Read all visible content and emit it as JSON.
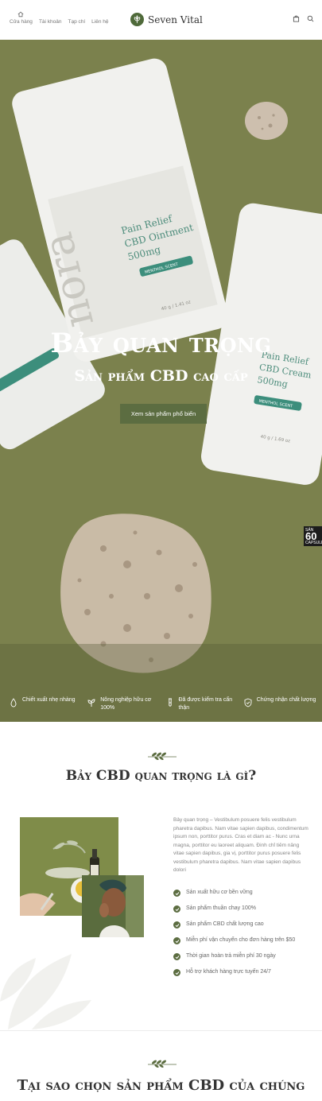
{
  "header": {
    "nav": [
      {
        "label": "Cửa hàng",
        "icon": "home-icon"
      },
      {
        "label": "Tài khoản"
      },
      {
        "label": "Tạp chí"
      },
      {
        "label": "Liên hệ"
      }
    ],
    "logo_text": "Seven Vital",
    "icons": [
      "bag-icon",
      "search-icon"
    ]
  },
  "hero": {
    "title": "Bảy quan trọng",
    "subtitle": "Sản phẩm CBD cao cấp",
    "button_label": "Xem sản phẩm phổ biến",
    "badge_top": "SẢN",
    "badge_num": "60",
    "badge_bottom": "CAPSULES",
    "features": [
      {
        "icon": "leaf-drop-icon",
        "text": "Chiết xuất nhẹ nhàng"
      },
      {
        "icon": "sprout-icon",
        "text": "Nông nghiệp hữu cơ 100%"
      },
      {
        "icon": "test-tube-icon",
        "text": "Đã được kiểm tra cẩn thận"
      },
      {
        "icon": "shield-check-icon",
        "text": "Chứng nhận chất lượng"
      }
    ]
  },
  "about": {
    "title": "Bảy CBD quan trọng là gì?",
    "paragraph": "Bảy quan trọng – Vestibulum posuere felis vestibulum pharetra dapibus. Nam vitae sapien dapibus, condimentum ipsum non, porttitor purus. Cras et diam ac - Nunc urna magna, porttitor eu laoreet aliquam. Đinh chỉ tiêm nâng vitae sapien dapibus, gia vị, porttitor purus posuere felis vestibulum pharetra dapibus. Nam vitae sapien dapibus dolori",
    "checklist": [
      "Sản xuất hữu cơ bền vững",
      "Sản phẩm thuần chay 100%",
      "Sản phẩm CBD chất lượng cao",
      "Miễn phí vận chuyển cho đơn hàng trên $50",
      "Thời gian hoàn trả miễn phí 30 ngày",
      "Hỗ trợ khách hàng trực tuyến 24/7"
    ]
  },
  "why": {
    "title": "Tại sao chọn sản phẩm CBD của chúng"
  },
  "colors": {
    "accent": "#5c6d41",
    "hero_bg": "#7e8550"
  }
}
